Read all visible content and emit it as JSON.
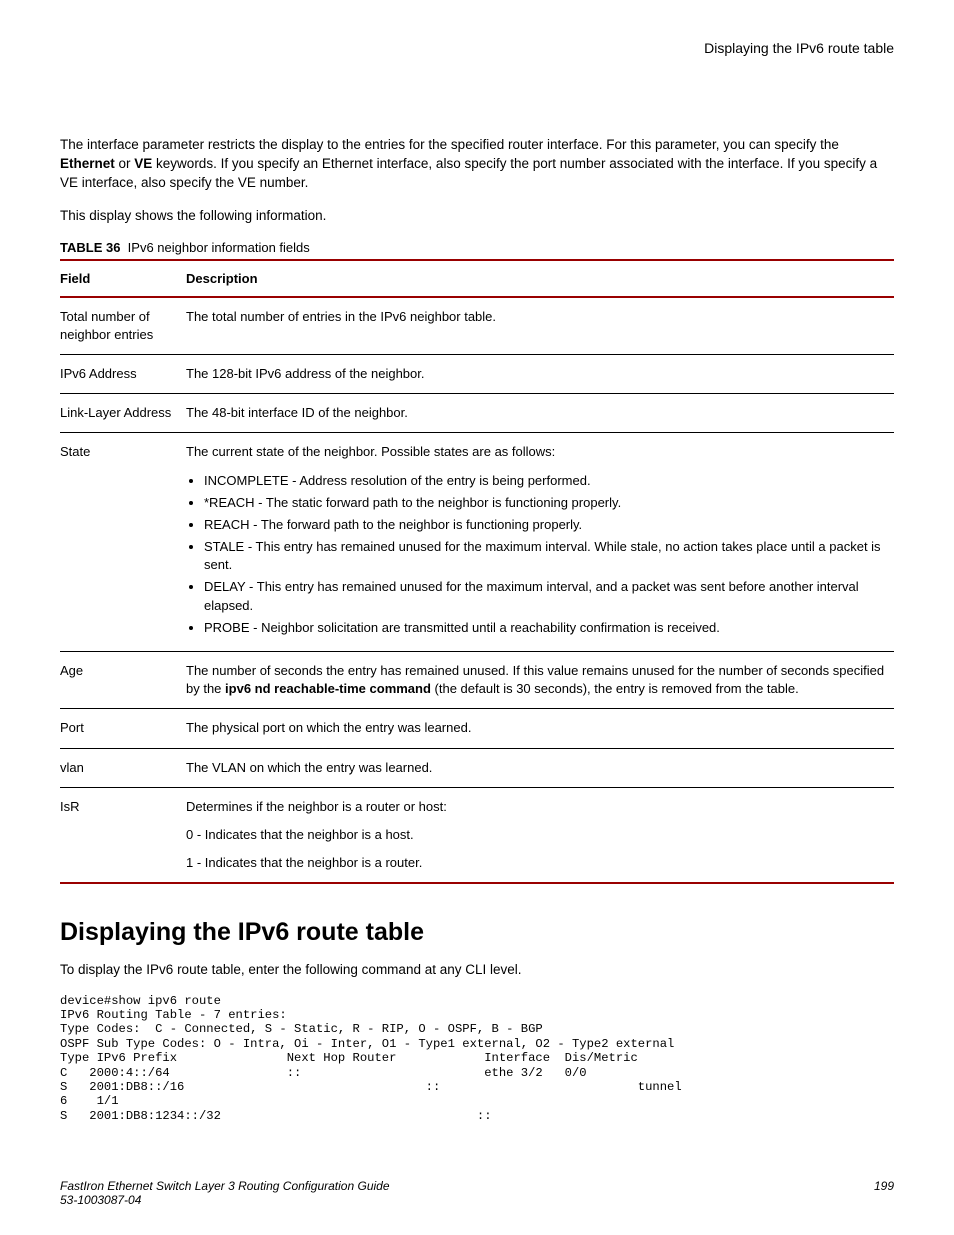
{
  "running_head": "Displaying the IPv6 route table",
  "para1_pre": "The interface parameter restricts the display to the entries for the specified router interface. For this parameter, you can specify the ",
  "para1_kw1": "Ethernet",
  "para1_mid": " or ",
  "para1_kw2": "VE",
  "para1_post": " keywords. If you specify an Ethernet interface, also specify the port number associated with the interface. If you specify a VE interface, also specify the VE number.",
  "para2": "This display shows the following information.",
  "table_caption_label": "TABLE 36",
  "table_caption_text": "IPv6 neighbor information fields",
  "th_field": "Field",
  "th_desc": "Description",
  "rows": {
    "r0": {
      "f": "Total number of neighbor entries",
      "d": "The total number of entries in the IPv6 neighbor table."
    },
    "r1": {
      "f": "IPv6 Address",
      "d": "The 128-bit IPv6 address of the neighbor."
    },
    "r2": {
      "f": "Link-Layer Address",
      "d": "The 48-bit interface ID of the neighbor."
    },
    "r3": {
      "f": "State",
      "d_intro": "The current state of the neighbor. Possible states are as follows:",
      "b0": "INCOMPLETE - Address resolution of the entry is being performed.",
      "b1": "*REACH - The static forward path to the neighbor is functioning properly.",
      "b2": "REACH - The forward path to the neighbor is functioning properly.",
      "b3": "STALE - This entry has remained unused for the maximum interval. While stale, no action takes place until a packet is sent.",
      "b4": "DELAY - This entry has remained unused for the maximum interval, and a packet was sent before another interval elapsed.",
      "b5": "PROBE - Neighbor solicitation are transmitted until a reachability confirmation is received."
    },
    "r4": {
      "f": "Age",
      "d_pre": "The number of seconds the entry has remained unused. If this value remains unused for the number of seconds specified by the ",
      "d_bold": "ipv6 nd reachable-time command",
      "d_post": " (the default is 30 seconds), the entry is removed from the table."
    },
    "r5": {
      "f": "Port",
      "d": "The physical port on which the entry was learned."
    },
    "r6": {
      "f": "vlan",
      "d": "The VLAN on which the entry was learned."
    },
    "r7": {
      "f": "IsR",
      "d0": "Determines if the neighbor is a router or host:",
      "d1": "0 - Indicates that the neighbor is a host.",
      "d2": "1 - Indicates that the neighbor is a router."
    }
  },
  "section_heading": "Displaying the IPv6 route table",
  "section_intro": "To display the IPv6 route table, enter the following command at any CLI level.",
  "cli": "device#show ipv6 route\nIPv6 Routing Table - 7 entries:\nType Codes:  C - Connected, S - Static, R - RIP, O - OSPF, B - BGP\nOSPF Sub Type Codes: O - Intra, Oi - Inter, O1 - Type1 external, O2 - Type2 external\nType IPv6 Prefix               Next Hop Router            Interface  Dis/Metric\nC   2000:4::/64                ::                         ethe 3/2   0/0\nS   2001:DB8::/16                                 ::                           tunnel\n6    1/1\nS   2001:DB8:1234::/32                                   ::",
  "footer_title": "FastIron Ethernet Switch Layer 3 Routing Configuration Guide",
  "footer_doc": "53-1003087-04",
  "footer_page": "199"
}
